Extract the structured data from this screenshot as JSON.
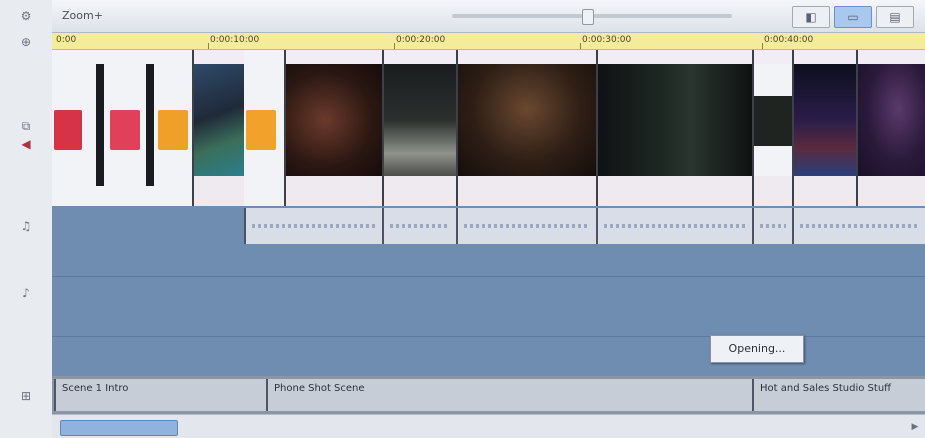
{
  "toolbar": {
    "title": "Zoom+",
    "buttons": [
      "◧",
      "▭",
      "▤"
    ],
    "active_button_index": 1
  },
  "ruler": {
    "timecodes": [
      "0:00",
      "0:00:10:00",
      "0:00:20:00",
      "0:00:30:00",
      "0:00:40:00"
    ]
  },
  "left_strip": {
    "icons": [
      "⚙",
      "⊕",
      "⧉",
      "◀",
      "♫",
      "♪",
      "⊞"
    ]
  },
  "tooltip": {
    "text": "Opening..."
  },
  "title_track": {
    "clips": [
      "Scene 1 Intro",
      "Phone Shot Scene",
      "Hot and Sales Studio Stuff"
    ]
  },
  "colors": {
    "track_blue": "#6e8db0",
    "ruler_yellow": "#f3ec9a",
    "active_button": "#a9c8ee"
  }
}
